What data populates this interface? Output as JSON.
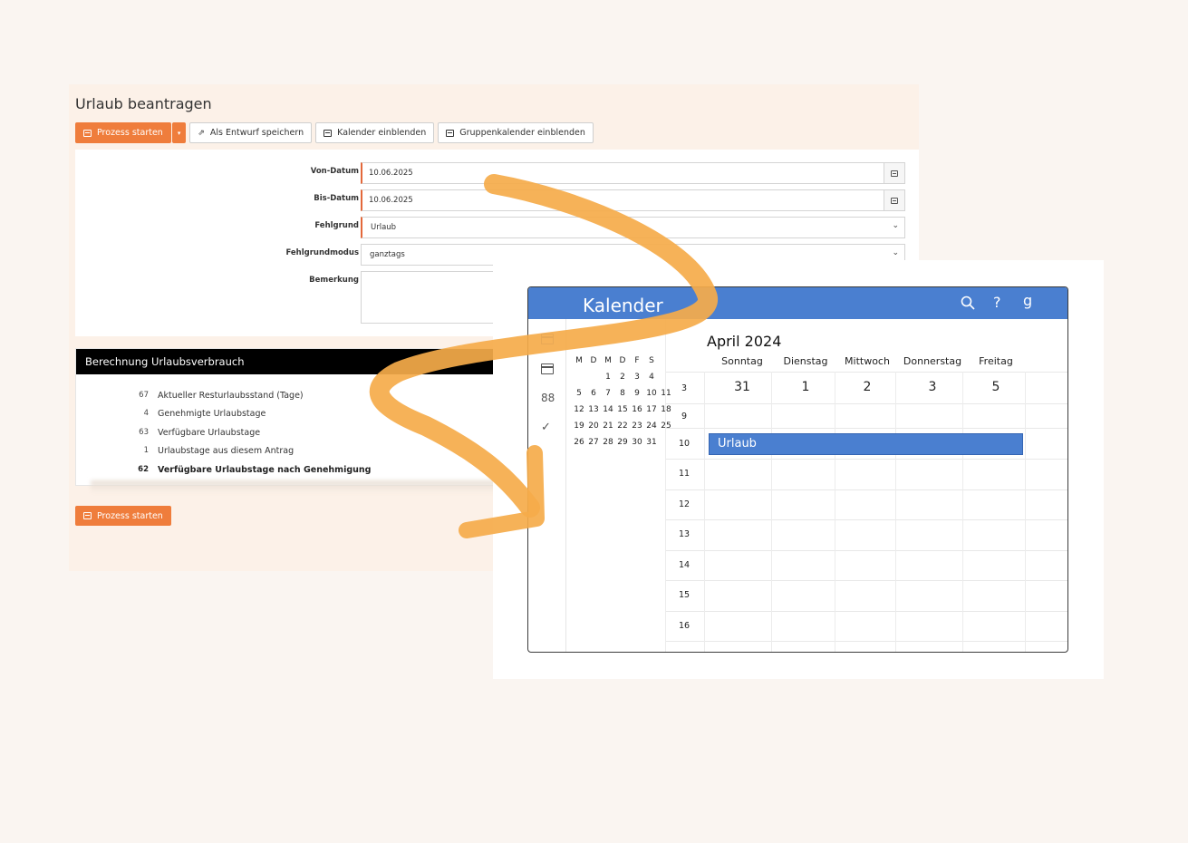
{
  "form": {
    "title": "Urlaub beantragen",
    "toolbar": {
      "start_label": "Prozess starten",
      "draft_label": "Als Entwurf speichern",
      "calendar_label": "Kalender einblenden",
      "group_calendar_label": "Gruppenkalender einblenden"
    },
    "fields": {
      "von_label": "Von-Datum",
      "von_value": "10.06.2025",
      "bis_label": "Bis-Datum",
      "bis_value": "10.06.2025",
      "grund_label": "Fehlgrund",
      "grund_value": "Urlaub",
      "modus_label": "Fehlgrundmodus",
      "modus_value": "ganztags",
      "bemerkung_label": "Bemerkung",
      "bemerkung_value": ""
    },
    "calc": {
      "header": "Berechnung Urlaubsverbrauch",
      "rows": [
        {
          "num": "67",
          "text": "Aktueller Resturlaubsstand (Tage)"
        },
        {
          "num": "4",
          "text": "Genehmigte Urlaubstage"
        },
        {
          "num": "63",
          "text": "Verfügbare Urlaubstage"
        },
        {
          "num": "1",
          "text": "Urlaubstage aus diesem Antrag"
        },
        {
          "num": "62",
          "text": "Verfügbare Urlaubstage nach Genehmigung"
        }
      ]
    },
    "bottom_start_label": "Prozess starten"
  },
  "calendar": {
    "title": "Kalender",
    "top_icons": {
      "search": "search-icon",
      "help": "?",
      "user": "g"
    },
    "mini": {
      "weekdays": [
        "M",
        "D",
        "M",
        "D",
        "F",
        "S"
      ],
      "weeks": [
        [
          "",
          "",
          "1",
          "2",
          "3",
          "4"
        ],
        [
          "5",
          "6",
          "7",
          "8",
          "9",
          "10",
          "11"
        ],
        [
          "12",
          "13",
          "14",
          "15",
          "16",
          "17",
          "18"
        ],
        [
          "19",
          "20",
          "21",
          "22",
          "23",
          "24",
          "25"
        ],
        [
          "26",
          "27",
          "28",
          "29",
          "30",
          "31"
        ]
      ]
    },
    "month": "April 2024",
    "days": [
      {
        "name": "Sonntag",
        "num": "31"
      },
      {
        "name": "Dienstag",
        "num": "1"
      },
      {
        "name": "Mittwoch",
        "num": "2"
      },
      {
        "name": "Donnerstag",
        "num": "3"
      },
      {
        "name": "Freitag",
        "num": "5"
      }
    ],
    "week_row_label": "3",
    "hours": [
      "9",
      "10",
      "11",
      "12",
      "13",
      "14",
      "15",
      "16"
    ],
    "event_label": "Urlaub",
    "colors": {
      "accent": "#4a7fd0",
      "orange": "#ef7d3c",
      "arrow": "#f5ab4a"
    }
  }
}
